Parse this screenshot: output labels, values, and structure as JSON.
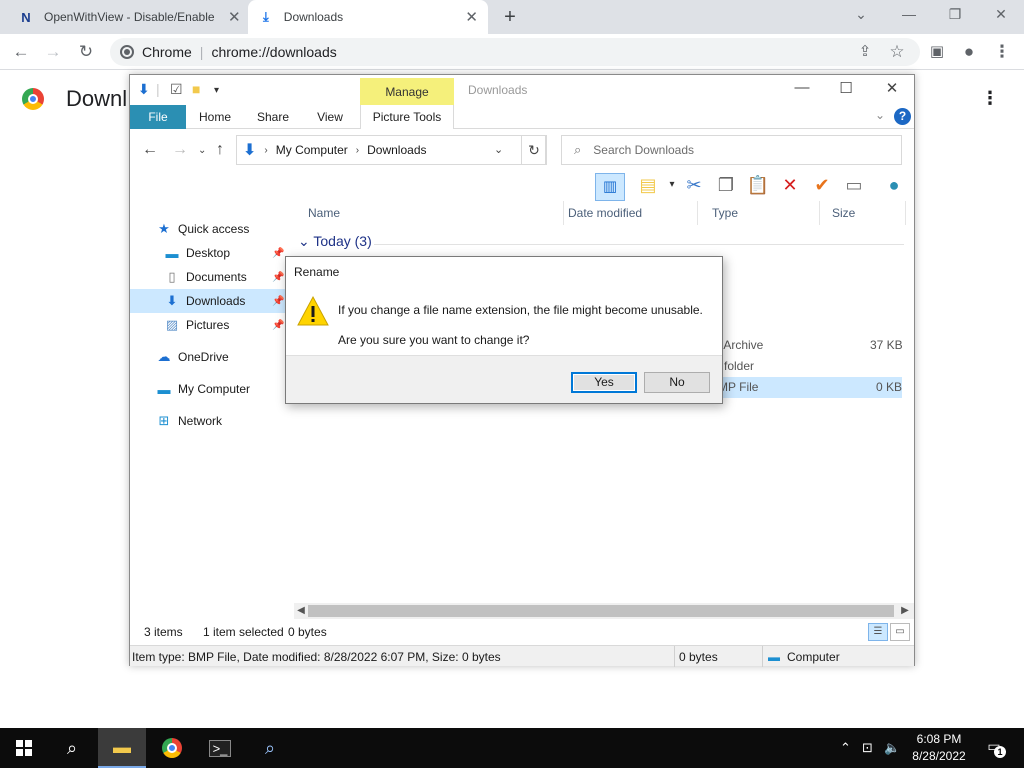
{
  "chrome": {
    "tabs": [
      {
        "title": "OpenWithView - Disable/Enable",
        "active": false
      },
      {
        "title": "Downloads",
        "active": true
      }
    ],
    "omnibox": {
      "site": "Chrome",
      "url": "chrome://downloads"
    },
    "page_title": "Downl"
  },
  "explorer": {
    "context_tab_group": "Manage",
    "window_title": "Downloads",
    "ribbon_tabs": [
      "File",
      "Home",
      "Share",
      "View",
      "Picture Tools"
    ],
    "breadcrumb": [
      "My Computer",
      "Downloads"
    ],
    "search_placeholder": "Search Downloads",
    "nav": {
      "quick_access": "Quick access",
      "desktop": "Desktop",
      "documents": "Documents",
      "downloads": "Downloads",
      "pictures": "Pictures",
      "onedrive": "OneDrive",
      "my_computer": "My Computer",
      "network": "Network"
    },
    "columns": {
      "name": "Name",
      "date": "Date modified",
      "type": "Type",
      "size": "Size"
    },
    "group": "Today (3)",
    "rows": [
      {
        "type": "o Archive",
        "size": "37 KB"
      },
      {
        "type": "e folder",
        "size": ""
      },
      {
        "type": "MP File",
        "size": "0 KB"
      }
    ],
    "status": {
      "items": "3 items",
      "selected": "1 item selected",
      "bytes": "0 bytes"
    },
    "details_bar": {
      "info": "Item type: BMP File, Date modified: 8/28/2022 6:07 PM, Size: 0 bytes",
      "size": "0 bytes",
      "location": "Computer"
    }
  },
  "dialog": {
    "title": "Rename",
    "message1": "If you change a file name extension, the file might become unusable.",
    "message2": "Are you sure you want to change it?",
    "yes": "Yes",
    "no": "No"
  },
  "taskbar": {
    "time": "6:08 PM",
    "date": "8/28/2022",
    "notifications": "1"
  },
  "colors": {
    "file_tab": "#2b8fb3",
    "context_tab": "#f5f07b",
    "selection": "#cce8ff",
    "accent": "#0078d7"
  }
}
